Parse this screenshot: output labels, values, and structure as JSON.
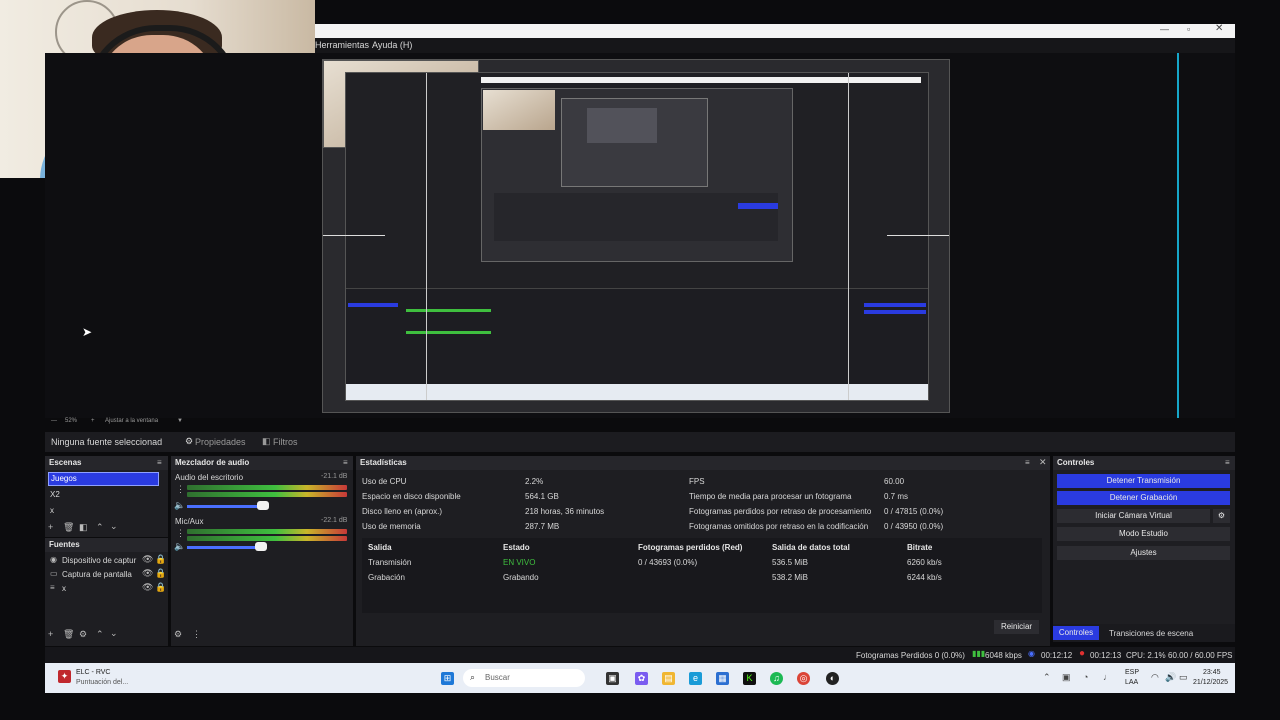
{
  "menu": {
    "items": [
      "Herramientas",
      "Ayuda (H)"
    ]
  },
  "zoom": {
    "percent": "52%",
    "fit_label": "Ajustar a la ventana"
  },
  "properties_bar": {
    "no_source": "Ninguna fuente seleccionad",
    "properties": "Propiedades",
    "filters": "Filtros"
  },
  "scenes": {
    "title": "Escenas",
    "items": [
      "Juegos",
      "X2",
      "x"
    ]
  },
  "sources": {
    "title": "Fuentes",
    "items": [
      "Dispositivo de captur",
      "Captura de pantalla",
      "x"
    ]
  },
  "mixer": {
    "title": "Mezclador de audio",
    "channels": [
      {
        "name": "Audio del escritorio",
        "db": "-21.1 dB"
      },
      {
        "name": "Mic/Aux",
        "db": "-22.1 dB"
      }
    ],
    "scale": [
      "-60",
      "-55",
      "-50",
      "-45",
      "-40",
      "-35",
      "-30",
      "-25",
      "-20",
      "-15",
      "-10",
      "-5",
      "0"
    ]
  },
  "stats": {
    "title": "Estadísticas",
    "left": [
      {
        "label": "Uso de CPU",
        "value": "2.2%"
      },
      {
        "label": "Espacio en disco disponible",
        "value": "564.1 GB"
      },
      {
        "label": "Disco lleno en (aprox.)",
        "value": "218 horas, 36 minutos"
      },
      {
        "label": "Uso de memoria",
        "value": "287.7 MB"
      }
    ],
    "right": [
      {
        "label": "FPS",
        "value": "60.00"
      },
      {
        "label": "Tiempo de media para procesar un fotograma",
        "value": "0.7 ms"
      },
      {
        "label": "Fotogramas perdidos por retraso de procesamiento",
        "value": "0 / 47815 (0.0%)"
      },
      {
        "label": "Fotogramas omitidos por retraso en la codificación",
        "value": "0 / 43950 (0.0%)"
      }
    ],
    "table": {
      "headers": [
        "Salida",
        "Estado",
        "Fotogramas perdidos (Red)",
        "Salida de datos total",
        "Bitrate"
      ],
      "rows": [
        [
          "Transmisión",
          "EN VIVO",
          "0 / 43693 (0.0%)",
          "536.5 MiB",
          "6260 kb/s"
        ],
        [
          "Grabación",
          "Grabando",
          "",
          "538.2 MiB",
          "6244 kb/s"
        ]
      ]
    },
    "reset": "Reiniciar"
  },
  "controls": {
    "title": "Controles",
    "buttons": [
      "Detener Transmisión",
      "Detener Grabación",
      "Iniciar Cámara Virtual",
      "Modo Estudio",
      "Ajustes"
    ],
    "tabs": [
      "Controles",
      "Transiciones de escena"
    ]
  },
  "status_bar": {
    "dropped": "Fotogramas Perdidos 0 (0.0%)",
    "bitrate": "6048 kbps",
    "stream_time": "00:12:12",
    "rec_time": "00:12:13",
    "cpu": "CPU: 2.1%",
    "fps": "60.00 / 60.00 FPS"
  },
  "taskbar": {
    "app_name": "ELC - RVC",
    "app_sub": "Puntuación del...",
    "search_placeholder": "Buscar",
    "lang": "ESP",
    "lang_sub": "LAA",
    "time": "23:45",
    "date": "21/12/2025"
  },
  "colors": {
    "accent": "#2a3be0",
    "live": "#3fbf3f",
    "panel": "#1e1e22"
  }
}
